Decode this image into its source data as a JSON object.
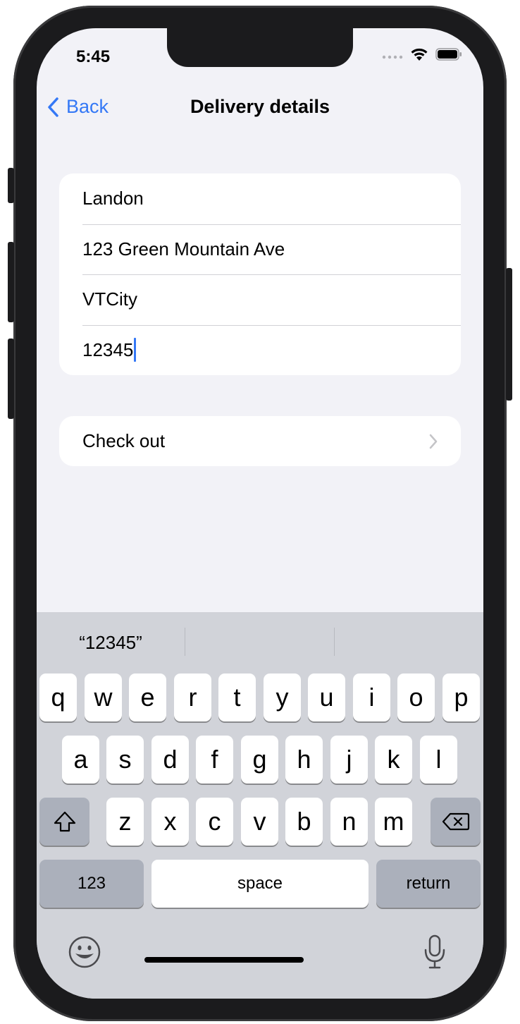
{
  "status_bar": {
    "time": "5:45"
  },
  "nav": {
    "back_label": "Back",
    "title": "Delivery details"
  },
  "form": {
    "fields": [
      {
        "value": "Landon"
      },
      {
        "value": "123 Green Mountain Ave"
      },
      {
        "value": "VTCity"
      },
      {
        "value": "12345"
      }
    ]
  },
  "checkout": {
    "label": "Check out"
  },
  "keyboard": {
    "suggestions": [
      "“12345”",
      "",
      ""
    ],
    "row1": [
      "q",
      "w",
      "e",
      "r",
      "t",
      "y",
      "u",
      "i",
      "o",
      "p"
    ],
    "row2": [
      "a",
      "s",
      "d",
      "f",
      "g",
      "h",
      "j",
      "k",
      "l"
    ],
    "row3": [
      "z",
      "x",
      "c",
      "v",
      "b",
      "n",
      "m"
    ],
    "numbers_label": "123",
    "space_label": "space",
    "return_label": "return"
  },
  "colors": {
    "accent": "#3478f6",
    "background": "#f2f2f7",
    "keyboard": "#d1d3d9"
  }
}
